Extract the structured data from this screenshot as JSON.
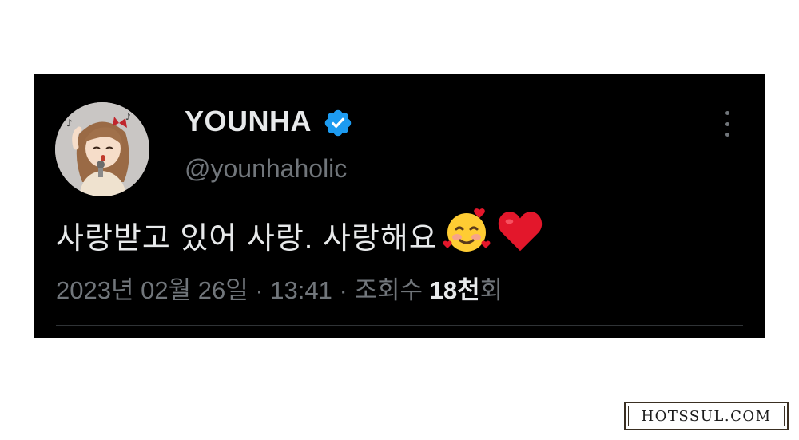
{
  "tweet": {
    "display_name": "YOUNHA",
    "handle": "@younhaholic",
    "text": "사랑받고 있어 사랑. 사랑해요",
    "emojis": [
      "smiling-face-with-hearts",
      "red-heart"
    ],
    "meta": {
      "date": "2023년 02월 26일",
      "separator": "·",
      "time": "13:41",
      "views_label": "조회수",
      "views_count": "18천",
      "views_suffix": "회"
    }
  },
  "watermark": {
    "text": "HOTSSUL.COM"
  },
  "colors": {
    "card_bg": "#000000",
    "text_primary": "#e7e9ea",
    "text_secondary": "#71767b",
    "verified": "#1d9bf0",
    "heart": "#e3172b"
  }
}
